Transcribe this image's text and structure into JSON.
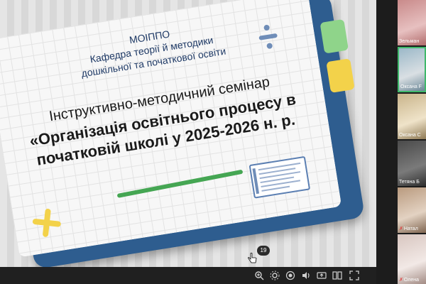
{
  "slide": {
    "org": "МОІППО",
    "dept_line1": "Кафедра теорії й методики",
    "dept_line2": "дошкільної та початкової освіти",
    "title_line1": "Інструктивно-методичний семінар",
    "title_line2": "«Організація освітнього процесу в",
    "title_line3": "початковій школі у 2025-2026 н. р.",
    "page_number": "19"
  },
  "toolbar": {
    "icons": [
      "zoom-in-icon",
      "settings-icon",
      "record-icon",
      "audio-icon",
      "share-icon",
      "layout-icon",
      "fullscreen-icon"
    ]
  },
  "participants": [
    {
      "name": "Зельман",
      "muted": false
    },
    {
      "name": "Оксана F",
      "muted": false
    },
    {
      "name": "Оксана С",
      "muted": false
    },
    {
      "name": "Тетяна Б",
      "muted": false
    },
    {
      "name": "Натал",
      "muted": true
    },
    {
      "name": "Олена",
      "muted": true
    }
  ],
  "colors": {
    "slide_back": "#2e5d8f",
    "title_text": "#1a1a1a",
    "accent_green": "#45a653",
    "accent_yellow": "#f3d24a",
    "active_speaker": "#3fb86a"
  }
}
